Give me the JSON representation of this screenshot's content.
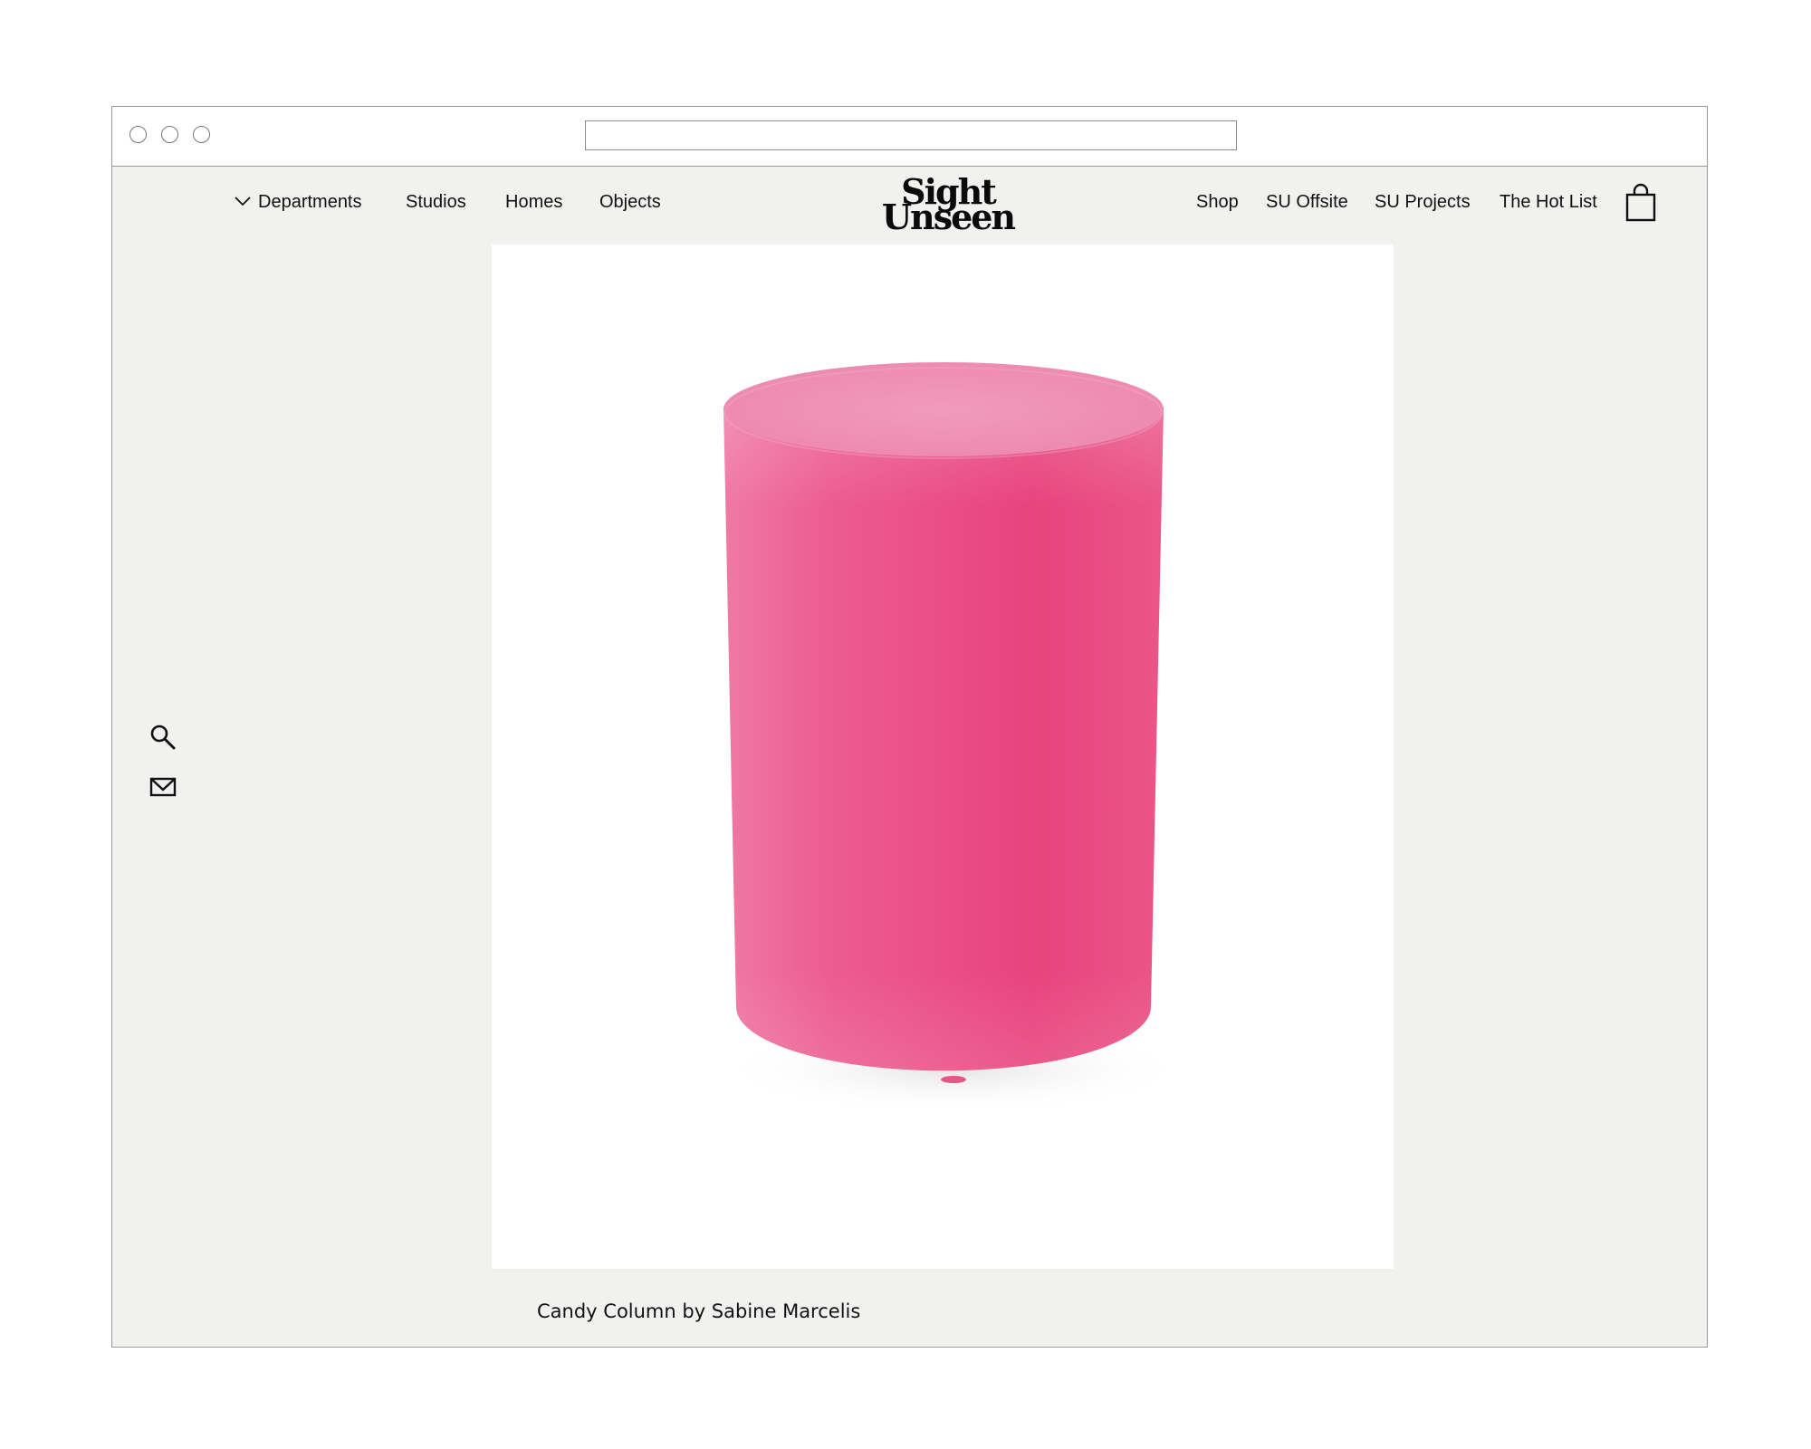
{
  "window": {
    "traffic_lights": [
      "close",
      "minimize",
      "zoom"
    ],
    "url": ""
  },
  "nav": {
    "departments_label": "Departments",
    "left_links": [
      "Studios",
      "Homes",
      "Objects"
    ],
    "right_links": [
      "Shop",
      "SU Offsite",
      "SU Projects",
      "The Hot List"
    ],
    "cart_icon": "shopping-bag-icon",
    "dropdown_icon": "chevron-down-icon"
  },
  "logo": {
    "line1": "Sight",
    "line2": "Unseen"
  },
  "sidebar": {
    "icons": [
      "search-icon",
      "mail-icon"
    ]
  },
  "hero": {
    "image_subject": "pink cylinder",
    "colors": {
      "cylinder": "#e94a84",
      "cylinder_top": "#ee8fb1",
      "background": "#ffffff"
    }
  },
  "caption": {
    "text": "Candy Column by Sabine Marcelis"
  },
  "colors": {
    "page_background": "#f1f1f0",
    "text": "#111111",
    "border": "#9a9a9a"
  }
}
